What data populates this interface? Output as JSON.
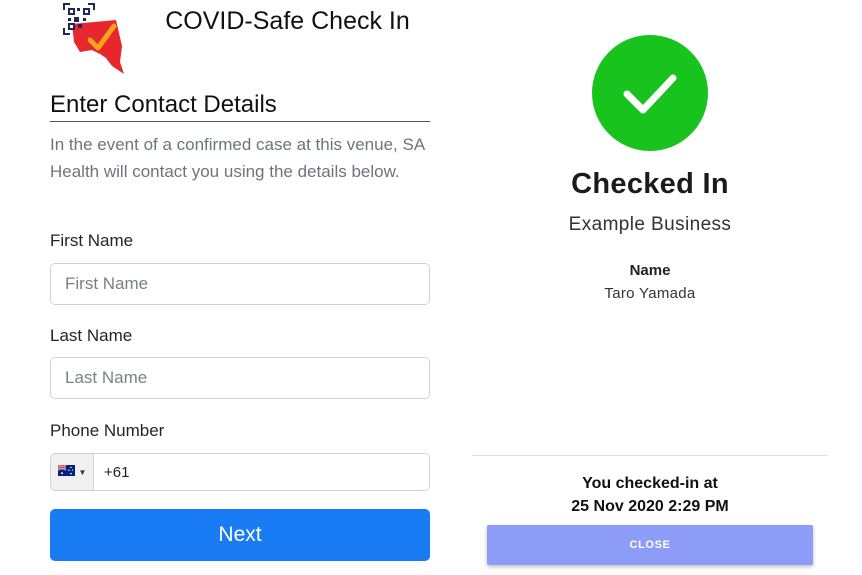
{
  "header": {
    "app_title": "COVID-Safe Check In",
    "logo_icon": "sa-health-qr-check-logo-icon"
  },
  "form": {
    "section_title": "Enter Contact Details",
    "info_text": "In the event of a confirmed case at this venue, SA Health will contact you using the details below.",
    "first_name": {
      "label": "First Name",
      "placeholder": "First Name",
      "value": ""
    },
    "last_name": {
      "label": "Last Name",
      "placeholder": "Last Name",
      "value": ""
    },
    "phone": {
      "label": "Phone Number",
      "country_icon": "australia-flag-icon",
      "value": "+61"
    },
    "next_label": "Next"
  },
  "confirmation": {
    "status_icon": "check-circle-icon",
    "title": "Checked In",
    "business_name": "Example Business",
    "name_label": "Name",
    "name_value": "Taro Yamada",
    "checked_at_line1": "You checked-in at",
    "checked_at_line2": "25 Nov 2020 2:29 PM",
    "close_label": "CLOSE"
  },
  "colors": {
    "primary": "#1a7cf5",
    "success": "#18c31e",
    "close_button": "#8c9cf7",
    "logo_red": "#e8262e",
    "logo_yellow": "#f2a51a",
    "logo_navy": "#1c2a5b"
  }
}
